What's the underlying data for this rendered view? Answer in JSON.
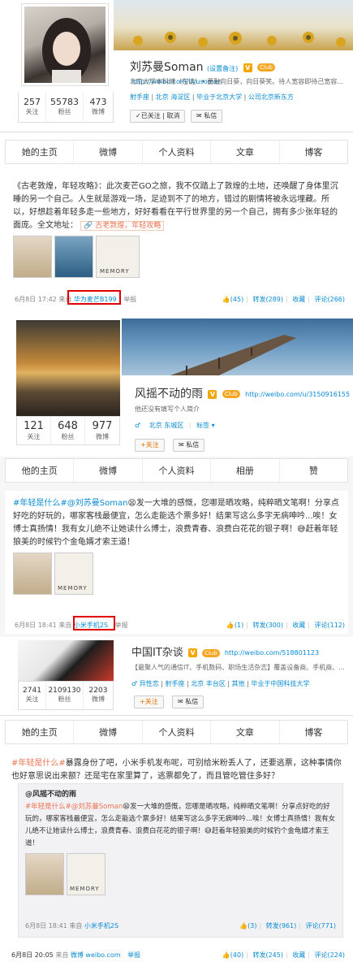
{
  "p1": {
    "name": "刘苏曼Soman",
    "remark": "(设置备注)",
    "club": "Club",
    "url": "http://weibo.com/liyusoman",
    "bio": "北京大学本科博（在读）• 要融向日葵，向日葵笑。待人宽容即待己宽容...",
    "tags": [
      "射手座",
      "北京 海淀区",
      "毕业于北京大学",
      "公司北京新东方"
    ],
    "stats": [
      {
        "num": "257",
        "label": "关注"
      },
      {
        "num": "55783",
        "label": "粉丝"
      },
      {
        "num": "473",
        "label": "微博"
      }
    ],
    "follow_btn": "已关注 | 取消",
    "msg_btn": "私信",
    "tabs": [
      "她的主页",
      "微博",
      "个人资料",
      "文章",
      "博客"
    ],
    "post_text": "《古老敦煌，年轻攻略》：此次麦芒GO之旅，我不仅踏上了敦煌的土地，还唤醒了身体里沉睡的另一个自己。人生就是游戏一场，足迹到不了的地方，错过的剧情将被永远埋藏。所以，好想趁着年轻多走一些地方，好好看看在平行世界里的另一个自己，拥有多少张年轻的面庞。全文地址：",
    "post_link": "古老敦煌，年轻攻略",
    "memory": "MEMORY",
    "time": "6月8日 17:42",
    "via": "来自",
    "source": "华为麦芒B199",
    "report": "举报",
    "likes": "(45)",
    "repost": "转发(289)",
    "fav": "收藏",
    "comment": "评论(266)"
  },
  "p2": {
    "name": "风摇不动的雨",
    "club": "Club",
    "url": "http://weibo.com/u/3150916155",
    "bio": "他还没有填写个人简介",
    "location": "北京 东城区",
    "tag": "标签",
    "stats": [
      {
        "num": "121",
        "label": "关注"
      },
      {
        "num": "648",
        "label": "粉丝"
      },
      {
        "num": "977",
        "label": "微博"
      }
    ],
    "follow_btn": "+关注",
    "msg_btn": "私信",
    "tabs": [
      "他的主页",
      "微博",
      "个人资料",
      "相册",
      "赞"
    ],
    "topic": "#年轻是什么#",
    "mention": "@刘苏曼Soman",
    "post_text": "发一大堆的感慨，您哪是晒攻略，纯粹晒文笔啊！分享点好吃的好玩的，哪家客栈最便宜，怎么走能选个票多好！结果写这么多字无病呻吟...唉！女博士真扬情！我有女儿绝不让她读什么博士，浪费青春、浪费白花花的银子啊！",
    "post_tail": "赶着年轻狼美的时候钓个金龟婿才索王道！",
    "memory": "MEMORY",
    "time": "6月8日 18:41",
    "via": "来自",
    "source": "小米手机2S",
    "report": "举报",
    "likes": "(1)",
    "repost": "转发(300)",
    "fav": "收藏",
    "comment": "评论(112)"
  },
  "p3": {
    "name": "中国IT杂谈",
    "club": "Club",
    "url": "http://weibo.com/518801123",
    "bio": "【最聚人气的通信IT、手机数码、职场生活杂志】覆盖设备商、手机商、...",
    "tags": [
      "异性恋",
      "射手座",
      "北京 丰台区",
      "其他",
      "毕业于中国科技大学"
    ],
    "stats": [
      {
        "num": "2741",
        "label": "关注"
      },
      {
        "num": "2109130",
        "label": "粉丝"
      },
      {
        "num": "2203",
        "label": "微博"
      }
    ],
    "follow_btn": "+关注",
    "msg_btn": "私信",
    "tabs": [
      "她的主页",
      "微博",
      "个人资料",
      "文章",
      "博客"
    ],
    "topic": "#年轻是什么#",
    "post_text": "暴露身份了吧，小米手机发布呢，可别给米粉丢人了，还要逃票，这种事情你也好意思说出来额？还是宅在家里算了，逃票都免了，而且管吃管住多好？",
    "repost_author": "@风摇不动的雨",
    "repost_topic": "#年轻是什么#",
    "repost_mention": "@刘苏曼Soman",
    "repost_text": "发一大堆的感慨，您哪是晒攻略，纯粹晒文笔啊！分享点好吃的好玩的，哪家客栈最便宜，怎么走能选个票多好！结果写这么多字无病呻吟...唉！女博士真扬情！我有女儿绝不让她读什么博士，浪费青春、浪费白花花的银子啊！",
    "repost_tail": "赶着年轻狼美的时候钓个金龟婿才索王道！",
    "memory": "MEMORY",
    "inner_time": "6月8日 18:41",
    "inner_via": "来自",
    "inner_source": "小米手机2S",
    "inner_likes": "(3)",
    "inner_repost": "转发(961)",
    "inner_comment": "评论(771)",
    "time": "6月8日 20:05",
    "via": "来自",
    "source": "微博 weibo.com",
    "report": "举报",
    "likes": "(40)",
    "repost": "转发(245)",
    "fav": "收藏",
    "comment": "评论(224)"
  },
  "colors": {
    "link": "#0a8cd2",
    "topic": "#eb7350",
    "red": "#e00000",
    "vip": "#f3a700"
  }
}
